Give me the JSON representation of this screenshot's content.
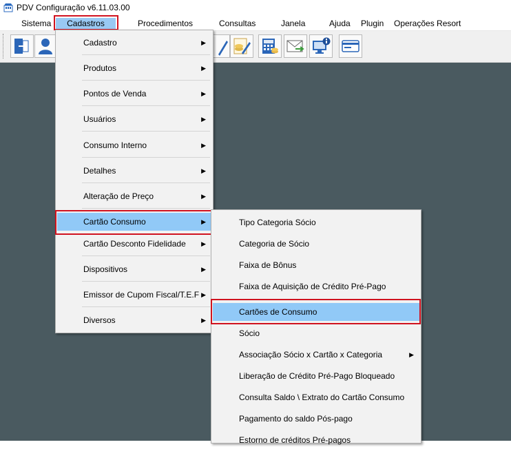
{
  "window": {
    "title": "PDV Configuração v6.11.03.00"
  },
  "menubar": {
    "items": [
      "Sistema",
      "Cadastros",
      "Procedimentos",
      "Consultas",
      "Janela",
      "Ajuda",
      "Plugin",
      "Operações Resort"
    ],
    "active": "Cadastros"
  },
  "toolbar": {
    "buttons": [
      "exit-icon",
      "user-icon",
      "edit-document-icon",
      "coins-edit-icon",
      "calculator-icon",
      "email-icon",
      "computer-info-icon",
      "card-icon"
    ]
  },
  "cadastros_menu": {
    "items": [
      {
        "label": "Cadastro",
        "submenu": true
      },
      {
        "label": "Produtos",
        "submenu": true
      },
      {
        "label": "Pontos de Venda",
        "submenu": true
      },
      {
        "label": "Usuários",
        "submenu": true
      },
      {
        "label": "Consumo Interno",
        "submenu": true
      },
      {
        "label": "Detalhes",
        "submenu": true
      },
      {
        "label": "Alteração de Preço",
        "submenu": true
      },
      {
        "label": "Cartão Consumo",
        "submenu": true,
        "selected": true
      },
      {
        "label": "Cartão Desconto Fidelidade",
        "submenu": true
      },
      {
        "label": "Dispositivos",
        "submenu": true
      },
      {
        "label": "Emissor de Cupom Fiscal/T.E.F",
        "submenu": true
      },
      {
        "label": "Diversos",
        "submenu": true
      }
    ]
  },
  "cartao_consumo_menu": {
    "items": [
      {
        "label": "Tipo Categoria Sócio",
        "submenu": false
      },
      {
        "label": "Categoria de Sócio",
        "submenu": false
      },
      {
        "label": "Faixa de Bônus",
        "submenu": false
      },
      {
        "label": "Faixa de Aquisição de Crédito Pré-Pago",
        "submenu": false
      },
      {
        "label": "Cartões de Consumo",
        "submenu": false,
        "selected": true
      },
      {
        "label": "Sócio",
        "submenu": false
      },
      {
        "label": "Associação Sócio x Cartão x Categoria",
        "submenu": true
      },
      {
        "label": "Liberação de Crédito Pré-Pago Bloqueado",
        "submenu": false
      },
      {
        "label": "Consulta Saldo \\ Extrato do Cartão Consumo",
        "submenu": false
      },
      {
        "label": "Pagamento do saldo Pós-pago",
        "submenu": false
      },
      {
        "label": "Estorno de créditos Pré-pagos",
        "submenu": false
      }
    ]
  },
  "colors": {
    "highlight": "#91c9f7",
    "annotation": "#d0121f",
    "workspace": "#4a5a60"
  }
}
